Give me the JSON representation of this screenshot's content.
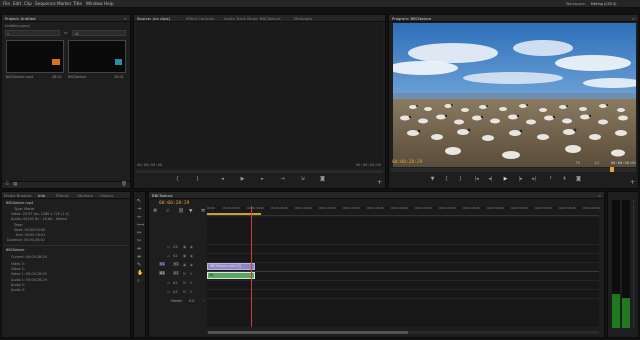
{
  "menu": {
    "items": [
      "File",
      "Edit",
      "Clip",
      "Sequence",
      "Marker",
      "Title",
      "Window",
      "Help"
    ],
    "workspace_label": "Workspace:",
    "workspace_value": "Editing (CS5.5)"
  },
  "project_panel": {
    "tab": "Project: Untitled",
    "project_file": "Untitled.prproj",
    "search_label": "In:",
    "search_scope": "All",
    "items": [
      {
        "name": "BBCNature.mp4",
        "duration": "28:01"
      },
      {
        "name": "BBCNature",
        "duration": "28:01"
      }
    ]
  },
  "source_monitor": {
    "tabs": [
      "Source: (no clips)",
      "Effect Controls",
      "Audio Track Mixer: BBCNature",
      "Metadata"
    ],
    "timecode_left": "00;00;00;00",
    "timecode_right": "00;00;00;00"
  },
  "program_monitor": {
    "tab": "Program: BBCNature",
    "timecode": "00:00:28:29",
    "fit": "Fit",
    "quality": "1/2",
    "duration": "00:00:30:01"
  },
  "info_panel": {
    "tabs": [
      "Media Browser",
      "Info",
      "Effects",
      "Markers",
      "History"
    ],
    "clip_name": "BBCNature.mp4",
    "lines": [
      "Type: Movie",
      "Video: 29.97 fps, 1280 x 720 (1.0)",
      "Audio: 44100 Hz - 16-bit - Stereo",
      "Tape:",
      "Start: 00:00:00:00",
      "End: 00:00:28:01",
      "Duration: 00:00:28:02"
    ],
    "sequence_name": "BBCNature",
    "sequence_lines": [
      "Current: 00:00:28:29",
      "Video 3:",
      "Video 2:",
      "Video 1: 00:00:28:29",
      "Audio 1: 00:00:28:29",
      "Audio 2:",
      "Audio 3:"
    ]
  },
  "timeline": {
    "tab": "BBCNature",
    "timecode": "00:00:28:29",
    "ruler": [
      "00:00",
      "00:00:15:00",
      "00:00:30:00",
      "00:00:45:00",
      "00:01:00:00",
      "00:01:15:00",
      "00:01:30:00",
      "00:01:45:00",
      "00:02:00:00",
      "00:02:15:00",
      "00:02:30:00",
      "00:02:45:00",
      "00:03:00:00",
      "00:03:15:00",
      "00:03:30:00",
      "00:03:45:00",
      "00:04:00:00"
    ],
    "video_tracks": [
      "V3",
      "V2",
      "V1"
    ],
    "audio_tracks": [
      "A1",
      "A2",
      "A3"
    ],
    "master_label": "Master",
    "master_value": "0.0",
    "video_clip": "BBCNature.mp4 [V]",
    "audio_clip": "fx"
  },
  "colors": {
    "accent": "#e2a43c",
    "playhead": "#d33b3b",
    "clip_video": "#8d86c9",
    "clip_audio": "#5aa75e"
  }
}
